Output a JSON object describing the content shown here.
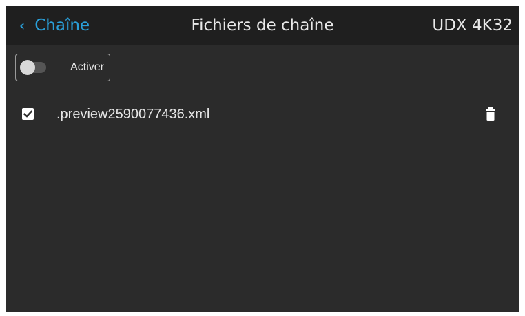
{
  "header": {
    "back_label": "Chaîne",
    "title": "Fichiers de chaîne",
    "device": "UDX 4K32"
  },
  "toggle": {
    "label": "Activer",
    "state": "off"
  },
  "files": [
    {
      "name": ".preview2590077436.xml",
      "checked": true
    }
  ],
  "icons": {
    "back": "chevron-left-icon",
    "checkbox": "checkbox-checked-icon",
    "delete": "trash-icon"
  },
  "colors": {
    "accent": "#2a9fd8",
    "header_bg": "#1f1f1f",
    "panel_bg": "#2b2b2b",
    "text": "#e6e6e6"
  }
}
